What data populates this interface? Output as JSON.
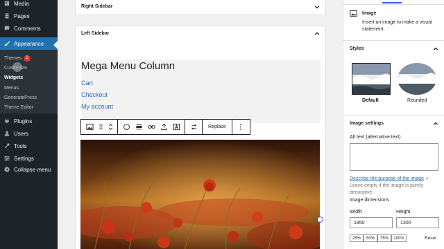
{
  "admin_menu": {
    "top_items": [
      {
        "label": "Media",
        "icon": "media-icon"
      },
      {
        "label": "Pages",
        "icon": "pages-icon"
      },
      {
        "label": "Comments",
        "icon": "comments-icon"
      }
    ],
    "appearance": {
      "label": "Appearance",
      "icon": "paintbrush-icon"
    },
    "submenu": [
      {
        "label": "Themes",
        "badge": "2"
      },
      {
        "label": "Customize"
      },
      {
        "label": "Widgets"
      },
      {
        "label": "Menus"
      },
      {
        "label": "GeneratePress"
      },
      {
        "label": "Theme Editor"
      }
    ],
    "bottom_items": [
      {
        "label": "Plugins",
        "icon": "plugins-icon"
      },
      {
        "label": "Users",
        "icon": "users-icon"
      },
      {
        "label": "Tools",
        "icon": "tools-icon"
      },
      {
        "label": "Settings",
        "icon": "settings-icon"
      },
      {
        "label": "Collapse menu",
        "icon": "collapse-icon"
      }
    ]
  },
  "editor": {
    "right_sidebar_title": "Right Sidebar",
    "left_sidebar_title": "Left Sidebar",
    "mega_title": "Mega Menu Column",
    "links": [
      "Cart",
      "Checkout",
      "My account"
    ],
    "toolbar": {
      "replace_label": "Replace"
    }
  },
  "settings_panel": {
    "block_name": "Image",
    "block_description": "Insert an image to make a visual statement.",
    "styles_title": "Styles",
    "style_default": "Default",
    "style_rounded": "Rounded",
    "image_settings_title": "Image settings",
    "alt_label": "Alt text (alternative text)",
    "alt_help_link": "Describe the purpose of the image",
    "alt_help_text": "Leave empty if the image is purely decorative.",
    "dimensions_title": "Image dimensions",
    "width_label": "Width",
    "height_label": "Height",
    "width_value": "1950",
    "height_value": "1300",
    "percent_options": [
      "25%",
      "50%",
      "75%",
      "100%"
    ],
    "reset_label": "Reset"
  },
  "colors": {
    "admin_bg": "#1d2327",
    "accent": "#2271b1",
    "badge": "#d63638",
    "link": "#2b6cb0"
  }
}
